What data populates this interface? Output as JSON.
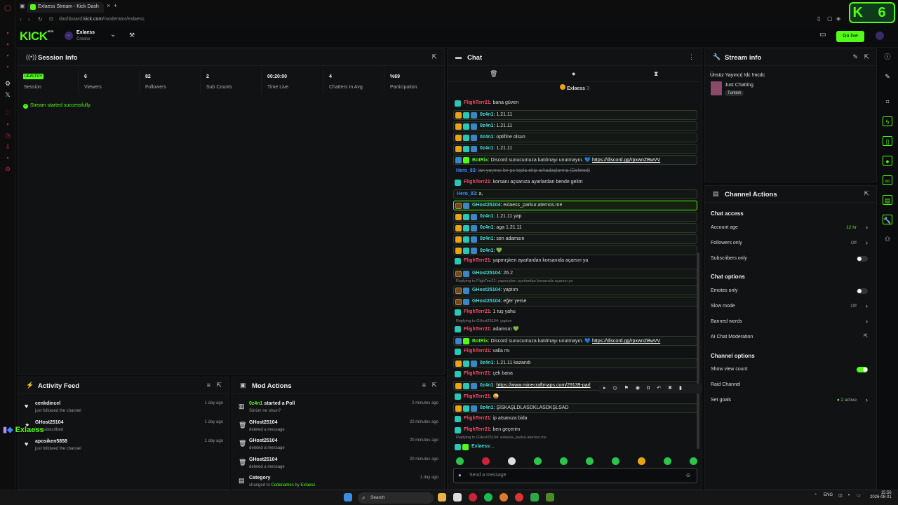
{
  "browser": {
    "tab_title": "Exlaess Stream - Kick Dash",
    "url_prefix": "dashboard.",
    "url_domain": "kick.com",
    "url_path": "/moderator/exlaess",
    "corner_badge": "K 6"
  },
  "header": {
    "logo": "KICK",
    "logo_sup": "BETA",
    "account_name": "Exlaess",
    "account_role": "Creator",
    "go_live": "Go live"
  },
  "session": {
    "title": "Session Info",
    "health": "HEALTHY",
    "session_label": "Session",
    "stats": [
      {
        "value": "6",
        "label": "Viewers"
      },
      {
        "value": "82",
        "label": "Followers"
      },
      {
        "value": "2",
        "label": "Sub Counts"
      },
      {
        "value": "00:20:00",
        "label": "Time Live"
      },
      {
        "value": "4",
        "label": "Chatters In Avg."
      },
      {
        "value": "%69",
        "label": "Participation"
      }
    ],
    "status_message": "Stream started successfully."
  },
  "activity": {
    "title": "Activity Feed",
    "items": [
      {
        "name": "cenkdincel",
        "action": "just followed the channel",
        "time": "1 day ago"
      },
      {
        "name": "GHost25104",
        "action": "just subscribed",
        "time": "1 day ago"
      },
      {
        "name": "aposiken5858",
        "action": "just followed the channel",
        "time": "1 day ago"
      }
    ],
    "overlay_text": "Exlaess"
  },
  "mod_actions": {
    "title": "Mod Actions",
    "items": [
      {
        "name": "0z4n1",
        "verb": " started a Poll",
        "detail": "Sürüm ne olsun?",
        "time": "2 minutes ago"
      },
      {
        "name": "GHost25104",
        "verb": "",
        "detail": "deleted a message",
        "time": "20 minutes ago"
      },
      {
        "name": "GHost25104",
        "verb": "",
        "detail": "deleted a message",
        "time": "20 minutes ago"
      },
      {
        "name": "GHost25104",
        "verb": "",
        "detail": "deleted a message",
        "time": "20 minutes ago"
      },
      {
        "name": "Category",
        "verb": "",
        "detail_pre": "changed to ",
        "detail_cat": "Codenames",
        "detail_by": " by ",
        "detail_user": "Exlaess",
        "time": "1 day ago"
      }
    ]
  },
  "chat": {
    "title": "Chat",
    "pinned_user": "Exlaess",
    "pinned_count": "3",
    "input_placeholder": "Send a message",
    "messages": [
      {
        "user": "FlighTerr21",
        "text": "bana güven"
      },
      {
        "user": "0z4n1",
        "text": "1.21.11"
      },
      {
        "user": "0z4n1",
        "text": "1.21.11"
      },
      {
        "user": "0z4n1",
        "text": "optifine olsun"
      },
      {
        "user": "0z4n1",
        "text": "1.21.11"
      },
      {
        "user": "BotRix",
        "text": "Discord sunucumuza katılmayı unutmayın. 💙",
        "link": "https://discord.gg/rpxwnZBwVV"
      },
      {
        "user": "Hero_83",
        "text": "lan yayıncı bir pc topla ekip arkadaşlarına (Deleted)"
      },
      {
        "user": "FlighTerr21",
        "text": "korsanı açsanıza ayarlardan bende gelim"
      },
      {
        "user": "Hero_83",
        "text": "a,"
      },
      {
        "user": "GHost25104",
        "text": "exlaess_parkur.aternos.me"
      },
      {
        "user": "0z4n1",
        "text": "1.21.11 yap"
      },
      {
        "user": "0z4n1",
        "text": "aga 1.21.11"
      },
      {
        "user": "0z4n1",
        "text": "sen adamsın"
      },
      {
        "user": "0z4n1",
        "text": "💚"
      },
      {
        "user": "FlighTerr21",
        "text": "yapmışken ayarlardan korsanıda açarsın ya"
      },
      {
        "user": "GHost25104",
        "text": "26.2"
      },
      {
        "reply": "Replying to FlighTerr21: yapmışken ayarlardan korsanıda açarsın ya"
      },
      {
        "user": "GHost25104",
        "text": "yaptım"
      },
      {
        "user": "GHost25104",
        "text": "eğer yerse"
      },
      {
        "user": "FlighTerr21",
        "text": "1 tuş yahu"
      },
      {
        "reply": "Replying to GHost25104: yaptım"
      },
      {
        "user": "FlighTerr21",
        "text": "adamsın 💚"
      },
      {
        "user": "BotRix",
        "text": "Discord sunucumuza katılmayı unutmayın. 💙",
        "link": "https://discord.gg/rpxwnZBwVV"
      },
      {
        "user": "FlighTerr21",
        "text": "valla mı"
      },
      {
        "user": "0z4n1",
        "text": "1.21.11 kazandı"
      },
      {
        "user": "FlighTerr21",
        "text": "çek bana"
      },
      {
        "user": "0z4n1",
        "text": "",
        "link": "https://www.minecraftmaps.com/29139-parl"
      },
      {
        "user": "FlighTerr21",
        "text": "😜"
      },
      {
        "user": "0z4n1",
        "text": "ŞİSKAŞLDLASDKLASDKŞLSAD"
      },
      {
        "user": "FlighTerr21",
        "text": "ip atsanıza bida"
      },
      {
        "user": "FlighTerr21",
        "text": "ben geçerim"
      },
      {
        "reply": "Replying to GHost25104: exlaess_parkur.aternos.me"
      },
      {
        "user": "Exlaess",
        "text": ","
      }
    ]
  },
  "stream_info": {
    "title": "Stream info",
    "stream_title": "Ünsüz Yayıncı| !dc !mcdc",
    "category": "Just Chatting",
    "tag": "Turkish"
  },
  "channel_actions": {
    "title": "Channel Actions",
    "chat_access": "Chat access",
    "account_age": "Account age",
    "account_age_val": "12 hr",
    "followers_only": "Followers only",
    "followers_only_val": "Off",
    "subscribers_only": "Subscribers only",
    "chat_options": "Chat options",
    "emotes_only": "Emotes only",
    "slow_mode": "Slow mode",
    "slow_mode_val": "Off",
    "banned_words": "Banned words",
    "ai_mod": "AI Chat Moderation",
    "channel_options": "Channel options",
    "show_view_count": "Show view count",
    "raid_channel": "Raid Channel",
    "set_goals": "Set goals",
    "set_goals_val": "2 active"
  },
  "taskbar": {
    "search": "Search",
    "lang": "ENG",
    "time": "15:56",
    "date": "2026-08-01"
  },
  "colors": {
    "accent": "#53fc18",
    "background": "#0b0c0d",
    "panel": "#111213"
  }
}
